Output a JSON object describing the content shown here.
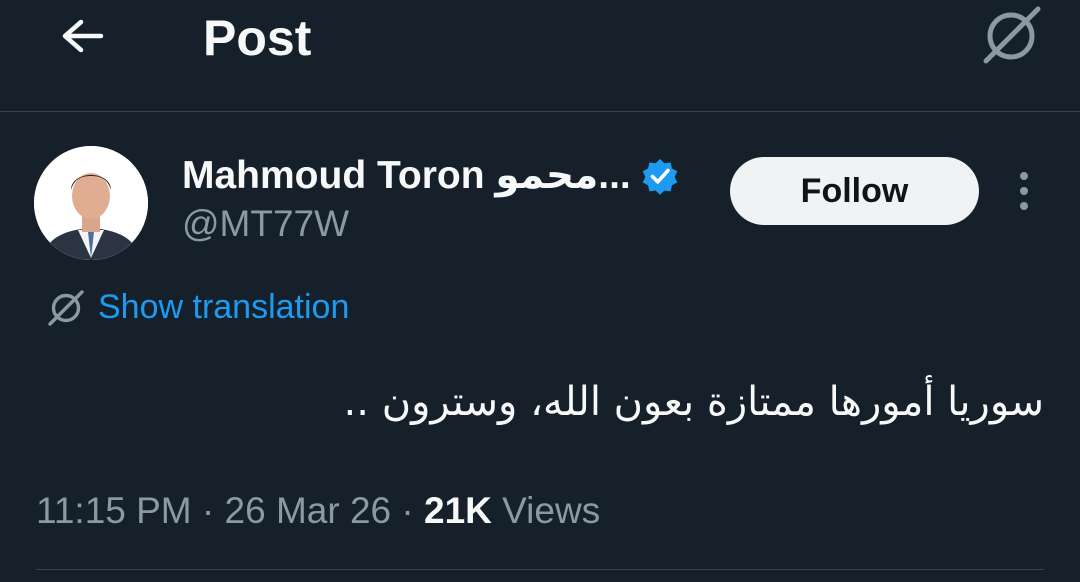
{
  "header": {
    "title": "Post"
  },
  "author": {
    "display_name": "Mahmoud Toron محمو...",
    "handle": "@MT77W",
    "verified": true
  },
  "actions": {
    "follow_label": "Follow"
  },
  "translation": {
    "label": "Show translation"
  },
  "post": {
    "text": "سوريا أمورها ممتازة بعون الله، وسترون .."
  },
  "meta": {
    "time": "11:15 PM",
    "separator": "·",
    "date": "26 Mar 26",
    "views_count": "21K",
    "views_label": "Views"
  },
  "colors": {
    "background": "#15202b",
    "accent": "#1d9bf0",
    "verified_badge": "#1d9bf0",
    "secondary_text": "#8b98a5"
  },
  "icons": {
    "back": "arrow-left-icon",
    "translate": "translate-icon",
    "verified": "verified-badge-icon",
    "more": "more-vertical-icon"
  }
}
